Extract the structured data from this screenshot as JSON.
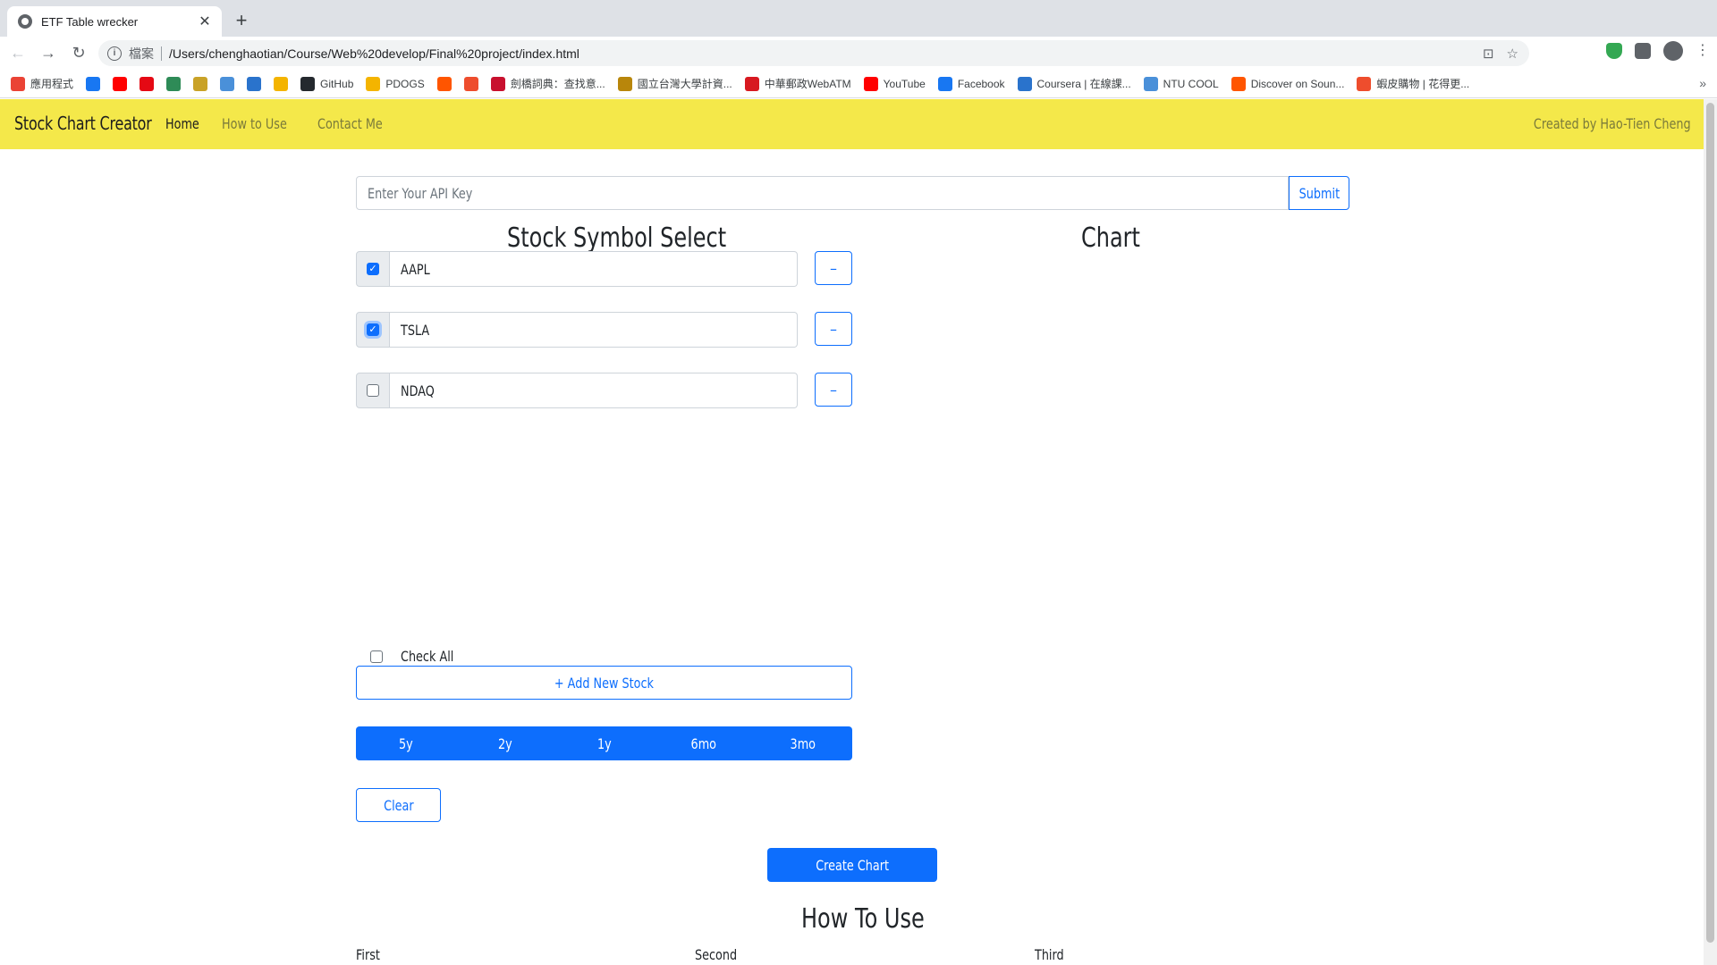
{
  "browser": {
    "tab_title": "ETF Table wrecker",
    "scheme_label": "檔案",
    "url": "/Users/chenghaotian/Course/Web%20develop/Final%20project/index.html",
    "bookmarks": [
      {
        "label": "應用程式",
        "color": "#ea4335"
      },
      {
        "label": "",
        "color": "#1877f2"
      },
      {
        "label": "",
        "color": "#ff0000"
      },
      {
        "label": "",
        "color": "#e50914"
      },
      {
        "label": "",
        "color": "#2e8b57"
      },
      {
        "label": "",
        "color": "#c9a227"
      },
      {
        "label": "",
        "color": "#4a90d9"
      },
      {
        "label": "",
        "color": "#2a73cc"
      },
      {
        "label": "",
        "color": "#f4b400"
      },
      {
        "label": "GitHub",
        "color": "#24292e"
      },
      {
        "label": "PDOGS",
        "color": "#f4b400"
      },
      {
        "label": "",
        "color": "#ff5500"
      },
      {
        "label": "",
        "color": "#ee4d2d"
      },
      {
        "label": "劍橋詞典：查找意...",
        "color": "#c8102e"
      },
      {
        "label": "國立台灣大學計資...",
        "color": "#b8860b"
      },
      {
        "label": "中華郵政WebATM",
        "color": "#d71920"
      },
      {
        "label": "YouTube",
        "color": "#ff0000"
      },
      {
        "label": "Facebook",
        "color": "#1877f2"
      },
      {
        "label": "Coursera | 在線課...",
        "color": "#2a73cc"
      },
      {
        "label": "NTU COOL",
        "color": "#4a90d9"
      },
      {
        "label": "Discover on Soun...",
        "color": "#ff5500"
      },
      {
        "label": "蝦皮購物 | 花得更...",
        "color": "#ee4d2d"
      }
    ],
    "more_label": "»"
  },
  "navbar": {
    "brand": "Stock Chart Creator",
    "links": [
      "Home",
      "How to Use",
      "Contact Me"
    ],
    "created_by": "Created by Hao-Tien Cheng",
    "color": "#f4e84a"
  },
  "api": {
    "placeholder": "Enter Your API Key",
    "submit_label": "Submit"
  },
  "headings": {
    "stock_select": "Stock Symbol Select",
    "chart": "Chart",
    "how_to_use": "How To Use"
  },
  "stocks": [
    {
      "symbol": "AAPL",
      "checked": true
    },
    {
      "symbol": "TSLA",
      "checked": true
    },
    {
      "symbol": "NDAQ",
      "checked": false
    }
  ],
  "remove_label": "–",
  "check_all_label": "Check All",
  "add_stock_label": "+ Add New Stock",
  "periods": [
    "5y",
    "2y",
    "1y",
    "6mo",
    "3mo"
  ],
  "clear_label": "Clear",
  "create_chart_label": "Create Chart",
  "steps": [
    "First",
    "Second",
    "Third"
  ],
  "accent_color": "#0d6efd"
}
